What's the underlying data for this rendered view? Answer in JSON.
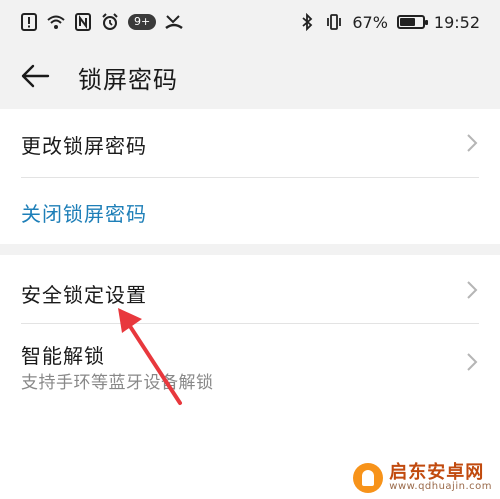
{
  "status": {
    "badge": "9+",
    "battery_pct": "67%",
    "battery_level": 0.67,
    "time": "19:52"
  },
  "header": {
    "title": "锁屏密码"
  },
  "section1": {
    "items": [
      {
        "label": "更改锁屏密码"
      },
      {
        "label": "关闭锁屏密码"
      }
    ],
    "link_color": "#1e7fb8"
  },
  "section2": {
    "items": [
      {
        "label": "安全锁定设置"
      },
      {
        "label": "智能解锁",
        "subtitle": "支持手环等蓝牙设备解锁"
      }
    ]
  },
  "annotation": {
    "arrow_color": "#e8383d"
  },
  "watermark": {
    "main": "启东安卓网",
    "url": "www.qdhuajin.com"
  }
}
